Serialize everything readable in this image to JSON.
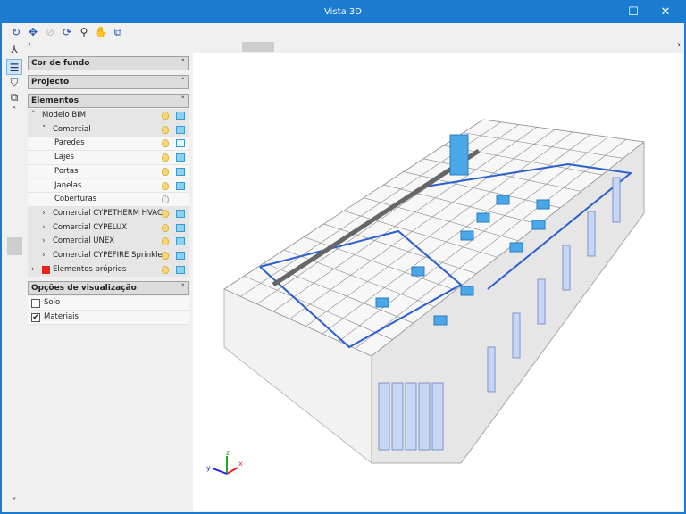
{
  "window": {
    "title": "Vista 3D",
    "maximize_icon": "maximize-icon",
    "close_icon": "close-icon"
  },
  "toolbar": {
    "tools": [
      "orbit-icon",
      "zoom-extents-icon",
      "zoom-previous-icon",
      "rotate-icon",
      "zoom-window-icon",
      "pan-hand-icon",
      "export-view-icon"
    ]
  },
  "panel": {
    "sections": {
      "background": "Cor de fundo",
      "project": "Projecto",
      "elements": "Elementos",
      "view_options": "Opções de visualização"
    },
    "tree": [
      {
        "label": "Modelo BIM",
        "expanded": true,
        "visible": true
      },
      {
        "label": "Comercial",
        "expanded": true,
        "visible": true
      },
      {
        "label": "Paredes",
        "visible": true
      },
      {
        "label": "Lajes",
        "visible": true
      },
      {
        "label": "Portas",
        "visible": true
      },
      {
        "label": "Janelas",
        "visible": true
      },
      {
        "label": "Coberturas",
        "visible": false
      },
      {
        "label": "Comercial CYPETHERM HVAC",
        "expanded": false,
        "visible": true
      },
      {
        "label": "Comercial CYPELUX",
        "expanded": false,
        "visible": true
      },
      {
        "label": "Comercial UNEX",
        "expanded": false,
        "visible": true
      },
      {
        "label": "Comercial CYPEFIRE Sprinklers",
        "expanded": false,
        "visible": true
      },
      {
        "label": "Elementos próprios",
        "expanded": false,
        "visible": true,
        "color": "#e8231a"
      }
    ],
    "options": [
      {
        "label": "Solo",
        "checked": false
      },
      {
        "label": "Materiais",
        "checked": true
      }
    ]
  },
  "axes": {
    "x": "x",
    "y": "y",
    "z": "z"
  },
  "colors": {
    "titlebar": "#1a7bd0",
    "duct": "#2a5fd0",
    "unit": "#4aa8e8"
  }
}
